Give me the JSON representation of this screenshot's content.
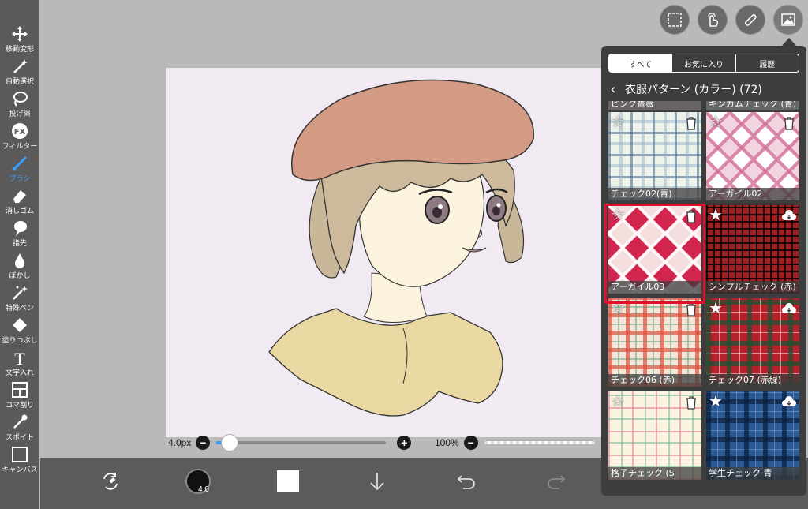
{
  "toolbar": {
    "tools": [
      {
        "label": "移動変形",
        "icon": "move-icon"
      },
      {
        "label": "自動選択",
        "icon": "magic-wand-icon"
      },
      {
        "label": "投げ縄",
        "icon": "lasso-icon"
      },
      {
        "label": "フィルター",
        "icon": "fx-icon"
      },
      {
        "label": "ブラシ",
        "icon": "brush-icon",
        "active": true
      },
      {
        "label": "消しゴム",
        "icon": "eraser-icon"
      },
      {
        "label": "指先",
        "icon": "finger-icon"
      },
      {
        "label": "ぼかし",
        "icon": "blur-drop-icon"
      },
      {
        "label": "特殊ペン",
        "icon": "special-pen-icon"
      },
      {
        "label": "塗りつぶし",
        "icon": "fill-icon"
      },
      {
        "label": "文字入れ",
        "icon": "text-icon"
      },
      {
        "label": "コマ割り",
        "icon": "frame-divide-icon"
      },
      {
        "label": "スポイト",
        "icon": "eyedropper-icon"
      },
      {
        "label": "キャンバス",
        "icon": "canvas-icon"
      }
    ]
  },
  "sliders": {
    "brush_size_label": "4.0px",
    "brush_size_fraction": 0.08,
    "opacity_label": "100%",
    "minus": "−",
    "plus": "+"
  },
  "bottombar": {
    "brush_size_value": "4.0",
    "current_color": "#ffffff"
  },
  "panel": {
    "tabs": [
      {
        "label": "すべて",
        "active": true
      },
      {
        "label": "お気に入り",
        "active": false
      },
      {
        "label": "履歴",
        "active": false
      }
    ],
    "back_glyph": "‹",
    "title": "衣服パターン (カラー) (72)",
    "partial_top_left": "ピンク薔薇",
    "partial_top_right": "ギンガムチェック (青)",
    "items": [
      {
        "name": "チェック02(青)",
        "action": "trash",
        "pattern": "plaid-blue"
      },
      {
        "name": "アーガイル02",
        "action": "trash",
        "pattern": "argyle-pink"
      },
      {
        "name": "アーガイル03",
        "action": "trash",
        "pattern": "argyle-red",
        "selected": true
      },
      {
        "name": "シンプルチェック (赤)",
        "action": "download",
        "pattern": "check-red-black"
      },
      {
        "name": "チェック06 (赤)",
        "action": "trash",
        "pattern": "plaid-red-light"
      },
      {
        "name": "チェック07 (赤緑)",
        "action": "download",
        "pattern": "tartan-red-green"
      },
      {
        "name": "格子チェック (S",
        "action": "trash",
        "pattern": "grid-pastel"
      },
      {
        "name": "学生チェック 青",
        "action": "download",
        "pattern": "tartan-blue"
      }
    ],
    "selected_color": "#e0102c"
  }
}
